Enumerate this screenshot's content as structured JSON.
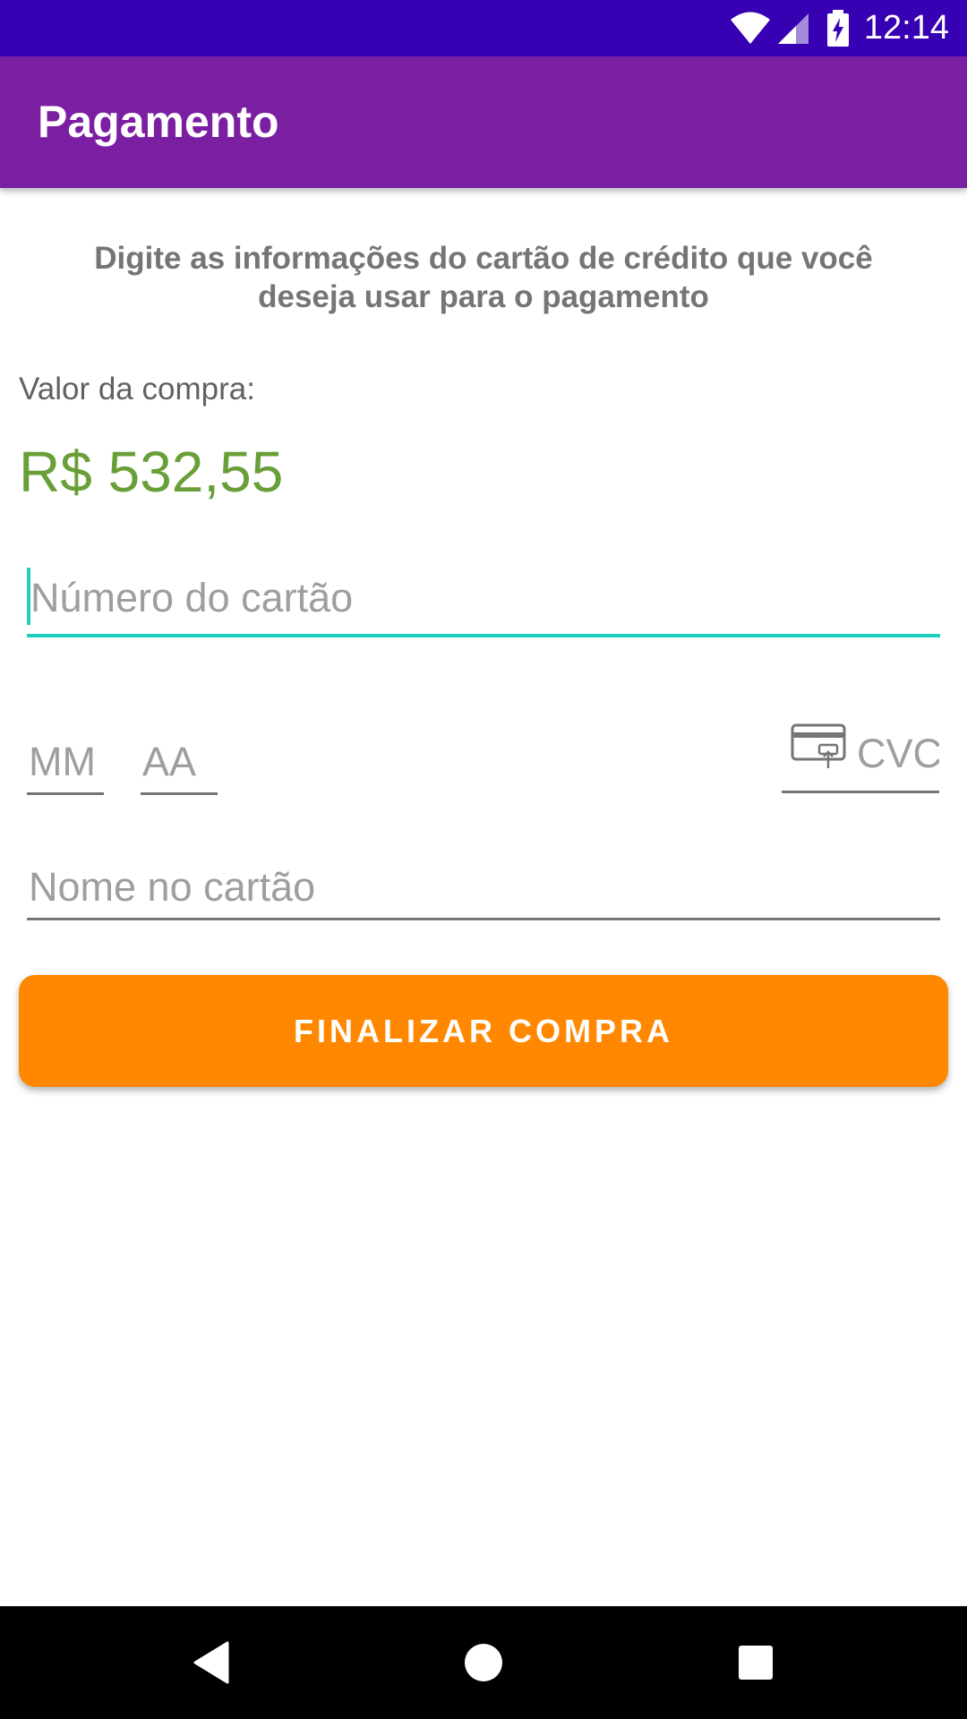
{
  "status_bar": {
    "time": "12:14",
    "icons": [
      "wifi-icon",
      "signal-icon",
      "battery-charging-icon"
    ],
    "background": "#3700B3"
  },
  "app_bar": {
    "title": "Pagamento",
    "background": "#7B1FA2"
  },
  "form": {
    "instruction": "Digite as informações do cartão de crédito que você deseja usar para o pagamento",
    "amount_label": "Valor da compra:",
    "amount_value": "R$ 532,55",
    "amount_color": "#689F38",
    "card_number": {
      "placeholder": "Número do cartão",
      "value": ""
    },
    "expiry_month": {
      "placeholder": "MM",
      "value": ""
    },
    "expiry_year": {
      "placeholder": "AA",
      "value": ""
    },
    "cvc": {
      "placeholder": "CVC",
      "value": "",
      "icon": "card-cvc-icon"
    },
    "card_name": {
      "placeholder": "Nome no cartão",
      "value": ""
    },
    "focus_color": "#1DCDBE"
  },
  "actions": {
    "finish_label": "FINALIZAR COMPRA",
    "finish_color": "#FF8800"
  },
  "nav_bar": {
    "buttons": [
      "back-icon",
      "home-icon",
      "recents-icon"
    ]
  }
}
